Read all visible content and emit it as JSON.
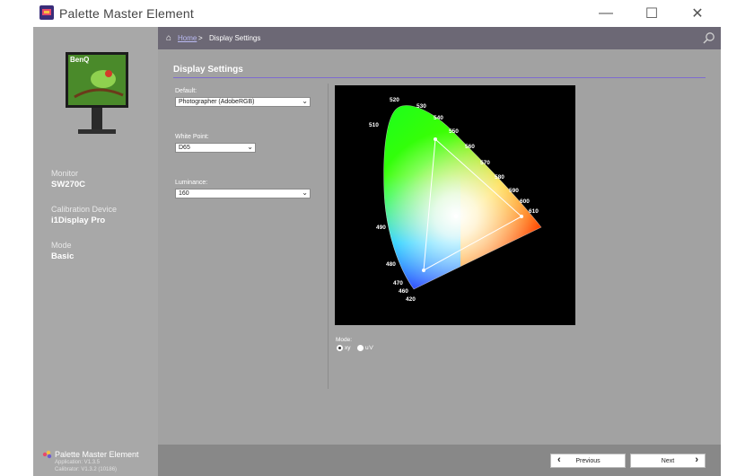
{
  "window": {
    "title": "Palette Master Element",
    "minimize_glyph": "—",
    "maximize_glyph": "☐",
    "close_glyph": "✕"
  },
  "sidebar": {
    "monitor_label": "Monitor",
    "monitor_value": "SW270C",
    "calibration_label": "Calibration Device",
    "calibration_value": "i1Display Pro",
    "mode_label": "Mode",
    "mode_value": "Basic",
    "monitor_brand": "BenQ",
    "brand_name": "Palette Master Element",
    "app_version": "Application: V1.3.5",
    "calibrator_version": "Calibrator: V1.3.2 (10186)"
  },
  "breadcrumb": {
    "home": "Home",
    "separator": ">",
    "current": "Display Settings"
  },
  "page": {
    "title": "Display Settings",
    "default_label": "Default:",
    "default_value": "Photographer (AdobeRGB)",
    "white_point_label": "White Point:",
    "white_point_value": "D65",
    "luminance_label": "Luminance:",
    "luminance_value": "160",
    "mode_label": "Mode:",
    "mode_options": [
      "xy",
      "u'v'"
    ],
    "mode_selected": "xy"
  },
  "gamut_chart": {
    "wavelength_labels": [
      "420",
      "460",
      "470",
      "480",
      "490",
      "510",
      "520",
      "530",
      "540",
      "550",
      "560",
      "570",
      "580",
      "590",
      "600",
      "610"
    ],
    "triangle_color": "#ffffff"
  },
  "footer": {
    "previous_label": "Previous",
    "next_label": "Next"
  },
  "colors": {
    "accent": "#7e6bd0",
    "topbar": "#6c6875",
    "sidebar": "#a8a8a8",
    "main": "#a2a2a2"
  }
}
